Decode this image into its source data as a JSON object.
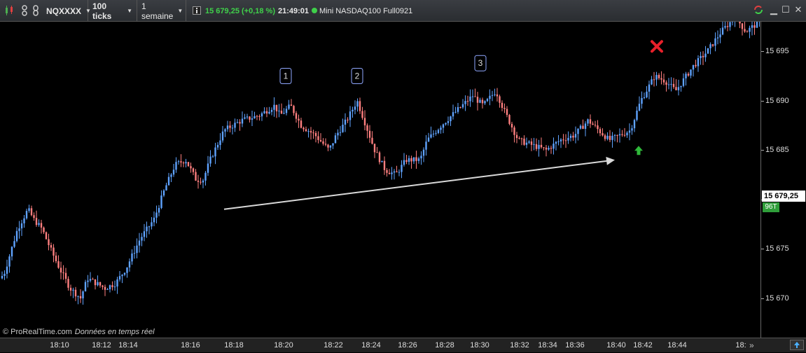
{
  "toolbar": {
    "symbol": "NQXXXX",
    "ticks": "100 ticks",
    "period": "1 semaine",
    "price_info": "15 679,25 (+0,18 %)",
    "time": "21:49:01",
    "instrument": "Mini NASDAQ100 Full0921"
  },
  "footer": {
    "copyright": "© ProRealTime.com",
    "status": "Données en temps réel"
  },
  "price_tag": "15 679,25",
  "ticks_tag": "96T",
  "colors": {
    "up": "#5fa3ff",
    "down": "#ff7f7f",
    "background": "#000000",
    "arrow": "#d9d9d9",
    "stop": "#e8202a",
    "entry": "#2fb83a"
  },
  "chart_data": {
    "type": "candlestick",
    "ylim": [
      15666,
      15698
    ],
    "y_ticks": [
      15670,
      15675,
      15680,
      15685,
      15690,
      15695
    ],
    "y_tick_labels": [
      "15 670",
      "15 675",
      "15 680",
      "15 685",
      "15 690",
      "15 695"
    ],
    "x_tick_labels": [
      "18:10",
      "18:12",
      "18:14",
      "18:16",
      "18:18",
      "18:20",
      "18:22",
      "18:24",
      "18:26",
      "18:28",
      "18:30",
      "18:32",
      "18:34",
      "18:36",
      "18:40",
      "18:42",
      "18:44",
      "18:"
    ],
    "x_tick_positions": [
      85,
      145,
      183,
      272,
      334,
      405,
      476,
      530,
      582,
      635,
      685,
      742,
      782,
      821,
      880,
      918,
      967,
      1058
    ],
    "anchors": [
      [
        0,
        15672
      ],
      [
        6,
        15672.5
      ],
      [
        25,
        15677
      ],
      [
        40,
        15679
      ],
      [
        48,
        15678
      ],
      [
        60,
        15677
      ],
      [
        72,
        15675
      ],
      [
        85,
        15673
      ],
      [
        100,
        15671
      ],
      [
        115,
        15670
      ],
      [
        125,
        15672
      ],
      [
        150,
        15671
      ],
      [
        165,
        15671.5
      ],
      [
        180,
        15673
      ],
      [
        200,
        15676
      ],
      [
        220,
        15678
      ],
      [
        235,
        15681
      ],
      [
        250,
        15683.5
      ],
      [
        265,
        15684
      ],
      [
        280,
        15682
      ],
      [
        290,
        15682
      ],
      [
        300,
        15684
      ],
      [
        320,
        15687
      ],
      [
        345,
        15688
      ],
      [
        370,
        15688.5
      ],
      [
        392,
        15689.5
      ],
      [
        400,
        15688.5
      ],
      [
        415,
        15689.5
      ],
      [
        430,
        15687.5
      ],
      [
        450,
        15686.5
      ],
      [
        470,
        15685
      ],
      [
        480,
        15686.5
      ],
      [
        495,
        15688
      ],
      [
        510,
        15690
      ],
      [
        520,
        15688
      ],
      [
        535,
        15685
      ],
      [
        550,
        15683
      ],
      [
        565,
        15682.5
      ],
      [
        580,
        15684
      ],
      [
        600,
        15684
      ],
      [
        610,
        15686
      ],
      [
        630,
        15687.5
      ],
      [
        660,
        15689.5
      ],
      [
        675,
        15690.5
      ],
      [
        690,
        15689.5
      ],
      [
        708,
        15691
      ],
      [
        720,
        15689
      ],
      [
        740,
        15686
      ],
      [
        760,
        15685.5
      ],
      [
        780,
        15685
      ],
      [
        800,
        15686
      ],
      [
        820,
        15686.5
      ],
      [
        840,
        15688
      ],
      [
        855,
        15687
      ],
      [
        870,
        15686
      ],
      [
        885,
        15686.5
      ],
      [
        900,
        15687
      ],
      [
        915,
        15690
      ],
      [
        935,
        15692.5
      ],
      [
        950,
        15692
      ],
      [
        965,
        15691
      ],
      [
        975,
        15692
      ],
      [
        990,
        15693.5
      ],
      [
        1010,
        15695
      ],
      [
        1030,
        15697
      ],
      [
        1050,
        15698.5
      ],
      [
        1065,
        15697
      ],
      [
        1085,
        15698
      ]
    ],
    "annotations": [
      {
        "type": "label",
        "text": "1",
        "x": 408,
        "price": 15692.5
      },
      {
        "type": "label",
        "text": "2",
        "x": 510,
        "price": 15692.5
      },
      {
        "type": "label",
        "text": "3",
        "x": 686,
        "price": 15693.8
      },
      {
        "type": "arrow",
        "from": [
          320,
          15679
        ],
        "to": [
          878,
          15684
        ]
      },
      {
        "type": "entry-arrow",
        "x": 912,
        "price": 15685
      },
      {
        "type": "stop-cross",
        "x": 938,
        "price": 15695.5
      }
    ]
  }
}
